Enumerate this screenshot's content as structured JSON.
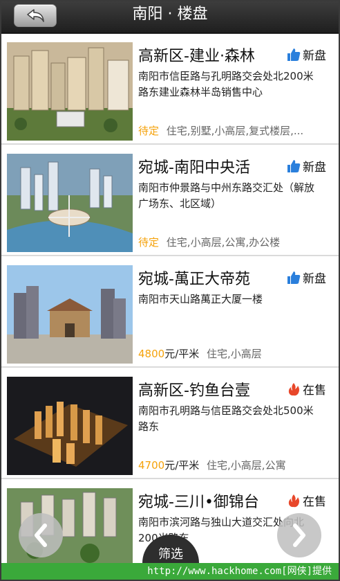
{
  "header": {
    "title": "南阳 · 楼盘",
    "back_icon": "back-arrow-icon"
  },
  "listings": [
    {
      "name": "高新区-建业·森林",
      "badge": "新盘",
      "badge_icon": "thumbs-up-icon",
      "address": "南阳市信臣路与孔明路交会处北200米路东建业森林半岛销售中心",
      "status": "待定",
      "price": "",
      "unit": "",
      "types": "住宅,别墅,小高层,复式楼层,..."
    },
    {
      "name": "宛城-南阳中央活",
      "badge": "新盘",
      "badge_icon": "thumbs-up-icon",
      "address": "南阳市仲景路与中州东路交汇处（解放广场东、北区域）",
      "status": "待定",
      "price": "",
      "unit": "",
      "types": "住宅,小高层,公寓,办公楼"
    },
    {
      "name": "宛城-萬正大帝苑",
      "badge": "新盘",
      "badge_icon": "thumbs-up-icon",
      "address": "南阳市天山路萬正大厦一楼",
      "status": "",
      "price": "4800",
      "unit": "元/平米",
      "types": "住宅,小高层"
    },
    {
      "name": "高新区-钓鱼台壹",
      "badge": "在售",
      "badge_icon": "flame-icon",
      "address": "南阳市孔明路与信臣路交会处北500米路东",
      "status": "",
      "price": "4700",
      "unit": "元/平米",
      "types": "住宅,小高层,公寓"
    },
    {
      "name": "宛城-三川•御锦台",
      "badge": "在售",
      "badge_icon": "flame-icon",
      "address": "南阳市滨河路与独山大道交汇处向北200米路东",
      "status": "",
      "price": "",
      "unit": "",
      "types": ""
    }
  ],
  "controls": {
    "filter_label": "筛选",
    "prev_icon": "chevron-left-icon",
    "next_icon": "chevron-right-icon"
  },
  "watermark": "http://www.hackhome.com[网侠]提供",
  "colors": {
    "accent_orange": "#f5a20a",
    "new_badge_blue": "#2a7fdc",
    "onsale_badge_red": "#e8472a",
    "watermark_green": "#3aa93a"
  }
}
